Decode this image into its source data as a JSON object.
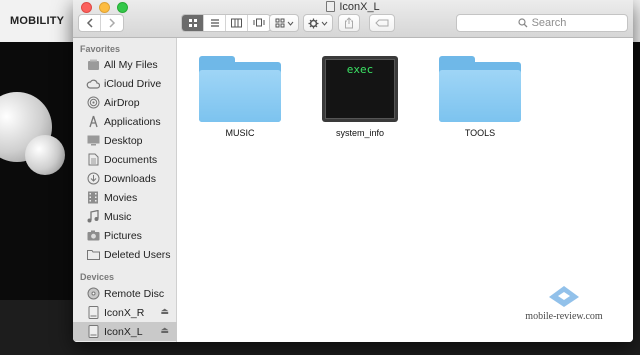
{
  "background_site": {
    "nav_label": "MOBILITY"
  },
  "window": {
    "title": "IconX_L",
    "toolbar": {
      "back_icon": "chevron-left-icon",
      "forward_icon": "chevron-right-icon",
      "view_modes": [
        "icon-view",
        "list-view",
        "column-view",
        "coverflow-view"
      ],
      "active_view": "icon-view",
      "search_placeholder": "Search"
    },
    "sidebar": {
      "favorites_header": "Favorites",
      "favorites": [
        {
          "label": "All My Files",
          "icon": "all-files-icon"
        },
        {
          "label": "iCloud Drive",
          "icon": "cloud-icon"
        },
        {
          "label": "AirDrop",
          "icon": "airdrop-icon"
        },
        {
          "label": "Applications",
          "icon": "applications-icon"
        },
        {
          "label": "Desktop",
          "icon": "desktop-icon"
        },
        {
          "label": "Documents",
          "icon": "documents-icon"
        },
        {
          "label": "Downloads",
          "icon": "downloads-icon"
        },
        {
          "label": "Movies",
          "icon": "movies-icon"
        },
        {
          "label": "Music",
          "icon": "music-icon"
        },
        {
          "label": "Pictures",
          "icon": "pictures-icon"
        },
        {
          "label": "Deleted Users",
          "icon": "folder-icon"
        }
      ],
      "devices_header": "Devices",
      "devices": [
        {
          "label": "Remote Disc",
          "icon": "disc-icon"
        },
        {
          "label": "IconX_R",
          "icon": "drive-icon"
        },
        {
          "label": "IconX_L",
          "icon": "drive-icon",
          "selected": true
        }
      ]
    },
    "files": [
      {
        "name": "MUSIC",
        "kind": "folder"
      },
      {
        "name": "system_info",
        "kind": "executable",
        "badge": "exec"
      },
      {
        "name": "TOOLS",
        "kind": "folder"
      }
    ]
  },
  "watermark": {
    "text": "mobile-review.com"
  },
  "colors": {
    "folder": "#7cc3ef",
    "exec_text": "#3be264",
    "sidebar_bg": "#ececec",
    "selection": "#c9c9c9"
  }
}
